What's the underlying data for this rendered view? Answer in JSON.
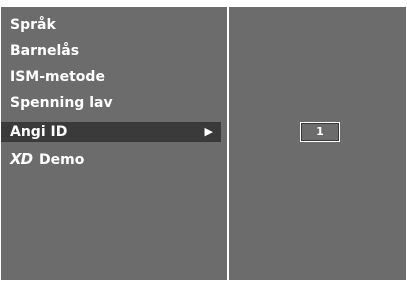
{
  "menu": {
    "items": [
      {
        "label": "Språk"
      },
      {
        "label": "Barnelås"
      },
      {
        "label": "ISM-metode"
      },
      {
        "label": "Spenning lav"
      },
      {
        "label": "Angi ID",
        "arrow": "▶"
      },
      {
        "logo": "XD",
        "label": "Demo"
      }
    ],
    "selected_index": 4
  },
  "value_panel": {
    "id_value": "1"
  }
}
